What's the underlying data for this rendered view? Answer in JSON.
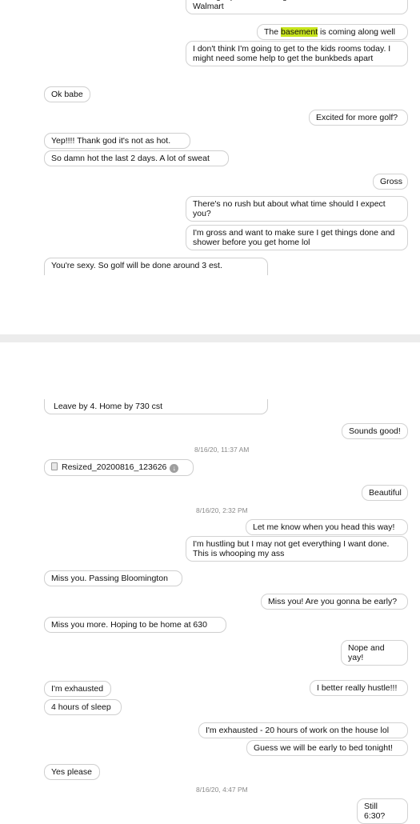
{
  "panel1": {
    "messages": [
      {
        "id": "m0",
        "text": "never get picture messages to send when I'm at Walmart"
      },
      {
        "id": "m1_pre",
        "text": "The "
      },
      {
        "id": "m1_hl",
        "text": "basement"
      },
      {
        "id": "m1_post",
        "text": " is coming along well"
      },
      {
        "id": "m2",
        "text": "I don't think I'm going to get to the kids rooms today. I might need some help to get the bunkbeds apart"
      },
      {
        "id": "m3",
        "text": "Ok babe"
      },
      {
        "id": "m4",
        "text": "Excited for more golf?"
      },
      {
        "id": "m5",
        "text": "Yep!!!! Thank god it's not as hot."
      },
      {
        "id": "m6",
        "text": "So damn hot the last 2 days.  A lot of sweat"
      },
      {
        "id": "m7",
        "text": "Gross"
      },
      {
        "id": "m8",
        "text": "There's no rush but about what time should I expect you?"
      },
      {
        "id": "m9",
        "text": "I'm gross and want to make sure I get things done and shower before you get home lol"
      },
      {
        "id": "m10",
        "text": "You're sexy. So golf will be done around 3 est."
      }
    ]
  },
  "panel2": {
    "messages": [
      {
        "id": "n0",
        "text": "Leave by 4.  Home by 730 cst"
      },
      {
        "id": "n1",
        "text": "Sounds good!"
      },
      {
        "id": "t1",
        "text": "8/16/20, 11:37 AM"
      },
      {
        "id": "n2",
        "text": "Resized_20200816_123626"
      },
      {
        "id": "n3",
        "text": "Beautiful"
      },
      {
        "id": "t2",
        "text": "8/16/20, 2:32 PM"
      },
      {
        "id": "n4",
        "text": "Let me know when you head this way!"
      },
      {
        "id": "n5",
        "text": "I'm hustling but I may not get everything I want done. This is whooping my ass"
      },
      {
        "id": "n6",
        "text": "Miss you.  Passing Bloomington"
      },
      {
        "id": "n7",
        "text": "Miss you! Are you gonna be early?"
      },
      {
        "id": "n8",
        "text": "Miss you more.  Hoping to be home at 630"
      },
      {
        "id": "n9",
        "text": "Nope and yay!"
      },
      {
        "id": "n10",
        "text": "I better really hustle!!!"
      },
      {
        "id": "n11",
        "text": "I'm exhausted"
      },
      {
        "id": "n12",
        "text": "4 hours of sleep"
      },
      {
        "id": "n13",
        "text": "I'm exhausted - 20 hours of work on the house lol"
      },
      {
        "id": "n14",
        "text": "Guess we will be early to bed tonight!"
      },
      {
        "id": "n15",
        "text": "Yes please"
      },
      {
        "id": "t3",
        "text": "8/16/20, 4:47 PM"
      },
      {
        "id": "n16",
        "text": "Still 6:30?"
      }
    ]
  },
  "icons": {
    "attachment": "image-file-icon",
    "download": "download-icon"
  },
  "colors": {
    "highlight": "#c7e41c",
    "divider": "#ececec",
    "border": "#cfcfcf",
    "timestamp": "#8a8a8a"
  }
}
